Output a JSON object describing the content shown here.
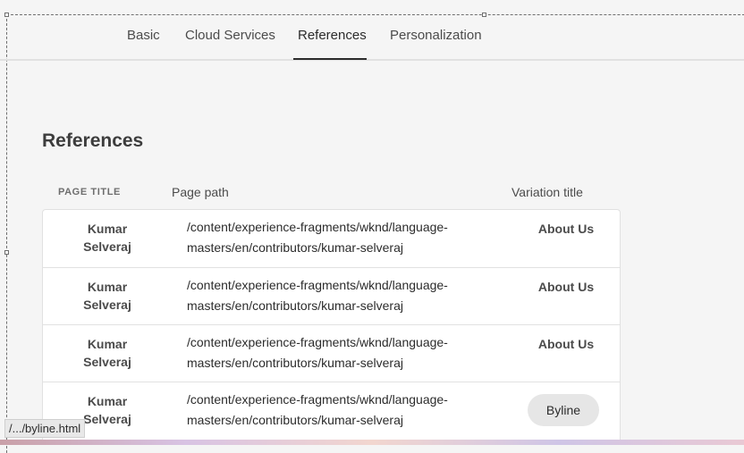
{
  "tabs": [
    {
      "label": "Basic"
    },
    {
      "label": "Cloud Services"
    },
    {
      "label": "References",
      "active": true
    },
    {
      "label": "Personalization"
    }
  ],
  "section": {
    "title": "References"
  },
  "table": {
    "headers": {
      "page_title": "PAGE TITLE",
      "page_path": "Page path",
      "variation_title": "Variation title"
    },
    "rows": [
      {
        "title": "Kumar Selveraj",
        "path": "/content/experience-fragments/wknd/language-masters/en/contributors/kumar-selveraj",
        "variation": "About Us"
      },
      {
        "title": "Kumar Selveraj",
        "path": "/content/experience-fragments/wknd/language-masters/en/contributors/kumar-selveraj",
        "variation": "About Us"
      },
      {
        "title": "Kumar Selveraj",
        "path": "/content/experience-fragments/wknd/language-masters/en/contributors/kumar-selveraj",
        "variation": "About Us"
      },
      {
        "title": "Kumar Selveraj",
        "path": "/content/experience-fragments/wknd/language-masters/en/contributors/kumar-selveraj",
        "variation": "Byline"
      }
    ]
  },
  "status_bar": {
    "link": "/.../byline.html"
  }
}
